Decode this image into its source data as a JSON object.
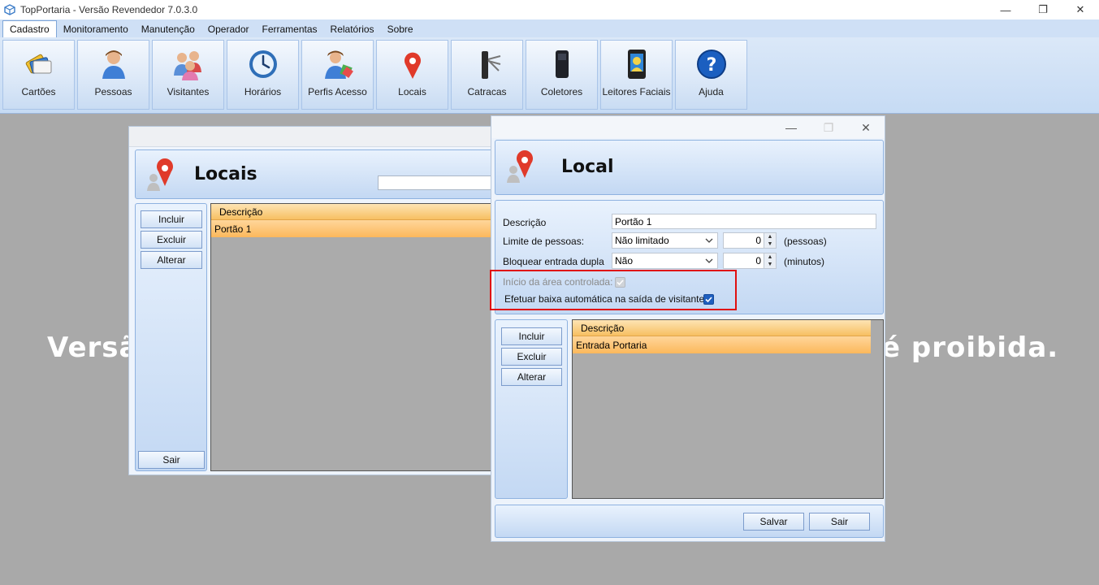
{
  "app": {
    "title": "TopPortaria - Versão Revendedor 7.0.3.0"
  },
  "window_controls": {
    "minimize": "—",
    "maximize": "❐",
    "close": "✕"
  },
  "menu": [
    "Cadastro",
    "Monitoramento",
    "Manutenção",
    "Operador",
    "Ferramentas",
    "Relatórios",
    "Sobre"
  ],
  "ribbon": [
    {
      "label": "Cartões",
      "icon": "cards-icon"
    },
    {
      "label": "Pessoas",
      "icon": "person-icon"
    },
    {
      "label": "Visitantes",
      "icon": "visitors-icon"
    },
    {
      "label": "Horários",
      "icon": "clock-icon"
    },
    {
      "label": "Perfis Acesso",
      "icon": "access-profile-icon"
    },
    {
      "label": "Locais",
      "icon": "location-pin-icon"
    },
    {
      "label": "Catracas",
      "icon": "turnstile-icon"
    },
    {
      "label": "Coletores",
      "icon": "collector-icon"
    },
    {
      "label": "Leitores Faciais",
      "icon": "face-reader-icon"
    },
    {
      "label": "Ajuda",
      "icon": "help-icon"
    }
  ],
  "watermark": {
    "left": "Versã",
    "right": "é proibida."
  },
  "locais": {
    "title": "Locais",
    "buttons": {
      "incluir": "Incluir",
      "excluir": "Excluir",
      "alterar": "Alterar",
      "sair": "Sair"
    },
    "grid": {
      "header": "Descrição",
      "rows": [
        "Portão 1"
      ]
    }
  },
  "local": {
    "title": "Local",
    "descricao_label": "Descrição",
    "descricao_value": "Portão 1",
    "limite_label": "Limite de pessoas:",
    "limite_value": "Não limitado",
    "limite_num": "0",
    "limite_unit": "(pessoas)",
    "bloquear_label": "Bloquear entrada dupla",
    "bloquear_value": "Não",
    "bloquear_num": "0",
    "bloquear_unit": "(minutos)",
    "inicio_label": "Início da área controlada:",
    "inicio_checked": true,
    "inicio_disabled": true,
    "baixa_label": "Efetuar baixa automática na saída de visitantes:",
    "baixa_checked": true,
    "buttons": {
      "incluir": "Incluir",
      "excluir": "Excluir",
      "alterar": "Alterar",
      "salvar": "Salvar",
      "sair": "Sair"
    },
    "grid": {
      "header": "Descrição",
      "rows": [
        "Entrada Portaria"
      ]
    }
  },
  "colors": {
    "highlight": "#e01010",
    "grid_header": "#f7bf62",
    "panel": "#c3d8f3"
  }
}
